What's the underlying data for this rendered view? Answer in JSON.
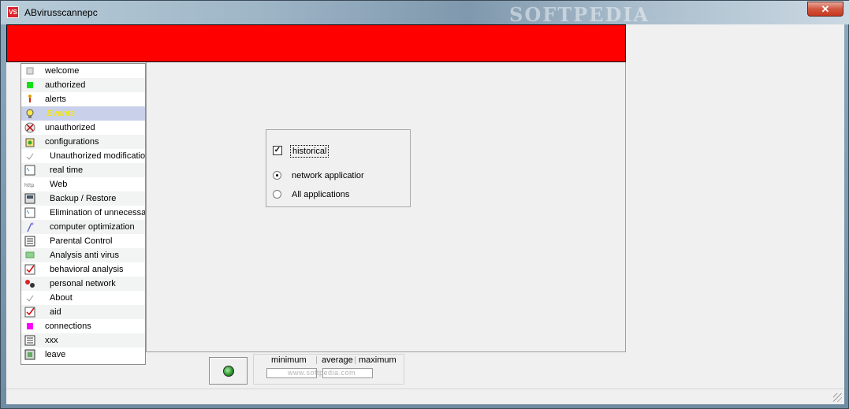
{
  "window": {
    "title": "ABvirusscannepc",
    "app_icon_text": "VS",
    "close_glyph": "✕",
    "watermark": "SOFTPEDIA"
  },
  "colors": {
    "banner": "#ff0000",
    "selected_row": "#c8d0ea",
    "selected_text": "#f5e60f"
  },
  "sidebar": {
    "items": [
      {
        "label": "welcome",
        "icon": "doc-icon",
        "sub": false
      },
      {
        "label": "authorized",
        "icon": "green-square-icon",
        "sub": false
      },
      {
        "label": "alerts",
        "icon": "alert-figure-icon",
        "sub": false
      },
      {
        "label": "Events",
        "icon": "lightbulb-icon",
        "sub": false,
        "selected": true
      },
      {
        "label": "unauthorized",
        "icon": "blocked-icon",
        "sub": false
      },
      {
        "label": "configurations",
        "icon": "config-icon",
        "sub": false
      },
      {
        "label": "Unauthorized modification",
        "icon": "check-small-icon",
        "sub": true
      },
      {
        "label": "real time",
        "icon": "window-icon",
        "sub": true
      },
      {
        "label": "Web",
        "icon": "http-icon",
        "sub": true
      },
      {
        "label": "Backup / Restore",
        "icon": "backup-icon",
        "sub": true
      },
      {
        "label": "Elimination of unnecessary",
        "icon": "window-icon",
        "sub": true
      },
      {
        "label": "computer optimization",
        "icon": "wand-icon",
        "sub": true
      },
      {
        "label": "Parental Control",
        "icon": "list-icon",
        "sub": true
      },
      {
        "label": "Analysis anti virus",
        "icon": "green-box-icon",
        "sub": true
      },
      {
        "label": "behavioral analysis",
        "icon": "red-check-icon",
        "sub": true
      },
      {
        "label": "personal network",
        "icon": "network-icon",
        "sub": true
      },
      {
        "label": "About",
        "icon": "check-small-icon",
        "sub": true
      },
      {
        "label": "aid",
        "icon": "red-check-icon",
        "sub": true
      },
      {
        "label": "connections",
        "icon": "magenta-square-icon",
        "sub": false
      },
      {
        "label": "xxx",
        "icon": "list-icon",
        "sub": false
      },
      {
        "label": "leave",
        "icon": "exit-icon",
        "sub": false
      }
    ]
  },
  "options": {
    "historical_label": "historical",
    "historical_checked": true,
    "radio_network_label": "network applicatior",
    "radio_all_label": "All applications",
    "selected_radio": "network"
  },
  "stats": {
    "minimum_label": "minimum",
    "average_label": "average",
    "maximum_label": "maximum",
    "watermark": "www.softpedia.com"
  }
}
